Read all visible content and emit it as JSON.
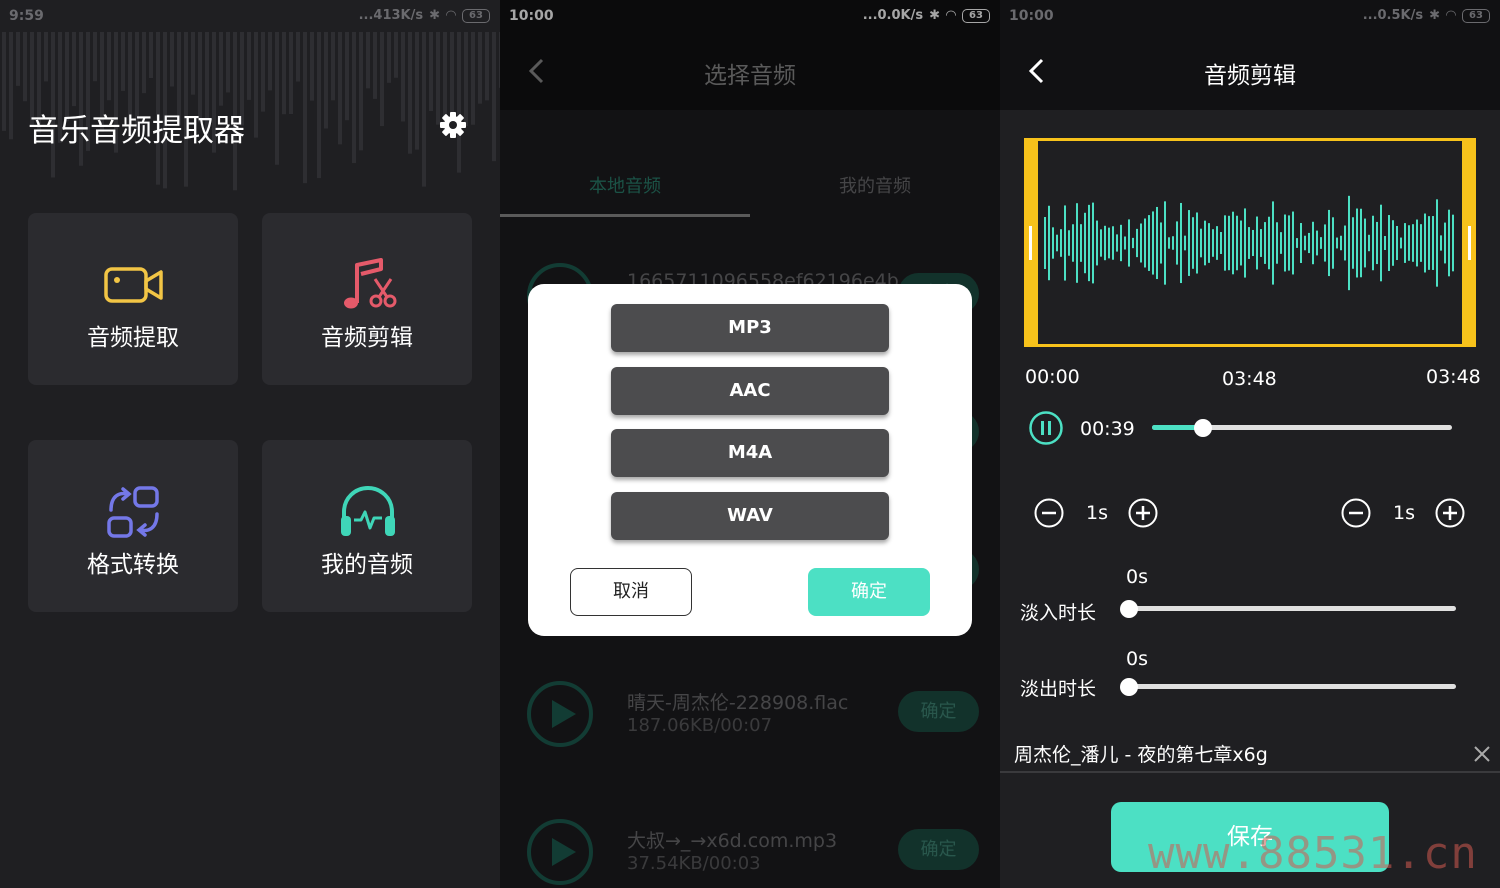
{
  "colors": {
    "accent": "#4ce0c4",
    "card": "#2b2b2f",
    "waveframe": "#f7c21b",
    "bg": "#1f1f22"
  },
  "screen1": {
    "status": {
      "time": "9:59",
      "speed": "...413K/s",
      "battery": "63"
    },
    "app_title": "音乐音频提取器",
    "cards": [
      {
        "label": "音频提取",
        "icon": "video-camera-icon"
      },
      {
        "label": "音频剪辑",
        "icon": "music-scissors-icon"
      },
      {
        "label": "格式转换",
        "icon": "format-convert-icon"
      },
      {
        "label": "我的音频",
        "icon": "headphones-icon"
      }
    ]
  },
  "screen2": {
    "status": {
      "time": "10:00",
      "speed": "...0.0K/s",
      "battery": "63"
    },
    "title": "选择音频",
    "tabs": [
      "本地音频",
      "我的音频"
    ],
    "rows": [
      {
        "name": "1665711096558ef62196e4b",
        "meta": "",
        "ok": "确定"
      },
      {
        "name": "晴天-周杰伦-228908.flac",
        "meta": "187.06KB/00:07",
        "ok": "确定"
      },
      {
        "name": "大叔→_→x6d.com.mp3",
        "meta": "37.54KB/00:03",
        "ok": "确定"
      }
    ],
    "dialog": {
      "formats": [
        "MP3",
        "AAC",
        "M4A",
        "WAV"
      ],
      "cancel": "取消",
      "confirm": "确定"
    }
  },
  "screen3": {
    "status": {
      "time": "10:00",
      "speed": "...0.5K/s",
      "battery": "63"
    },
    "title": "音频剪辑",
    "start_time": "00:00",
    "mid_time": "03:48",
    "end_time": "03:48",
    "position": "00:39",
    "progress": 0.17,
    "step_left": "1s",
    "step_right": "1s",
    "fade_in": {
      "label": "淡入时长",
      "value": "0s",
      "level": 0
    },
    "fade_out": {
      "label": "淡出时长",
      "value": "0s",
      "level": 0
    },
    "filename": "周杰伦_潘儿 - 夜的第七章x6g",
    "save": "保存",
    "watermark": "www.88531.cn"
  }
}
